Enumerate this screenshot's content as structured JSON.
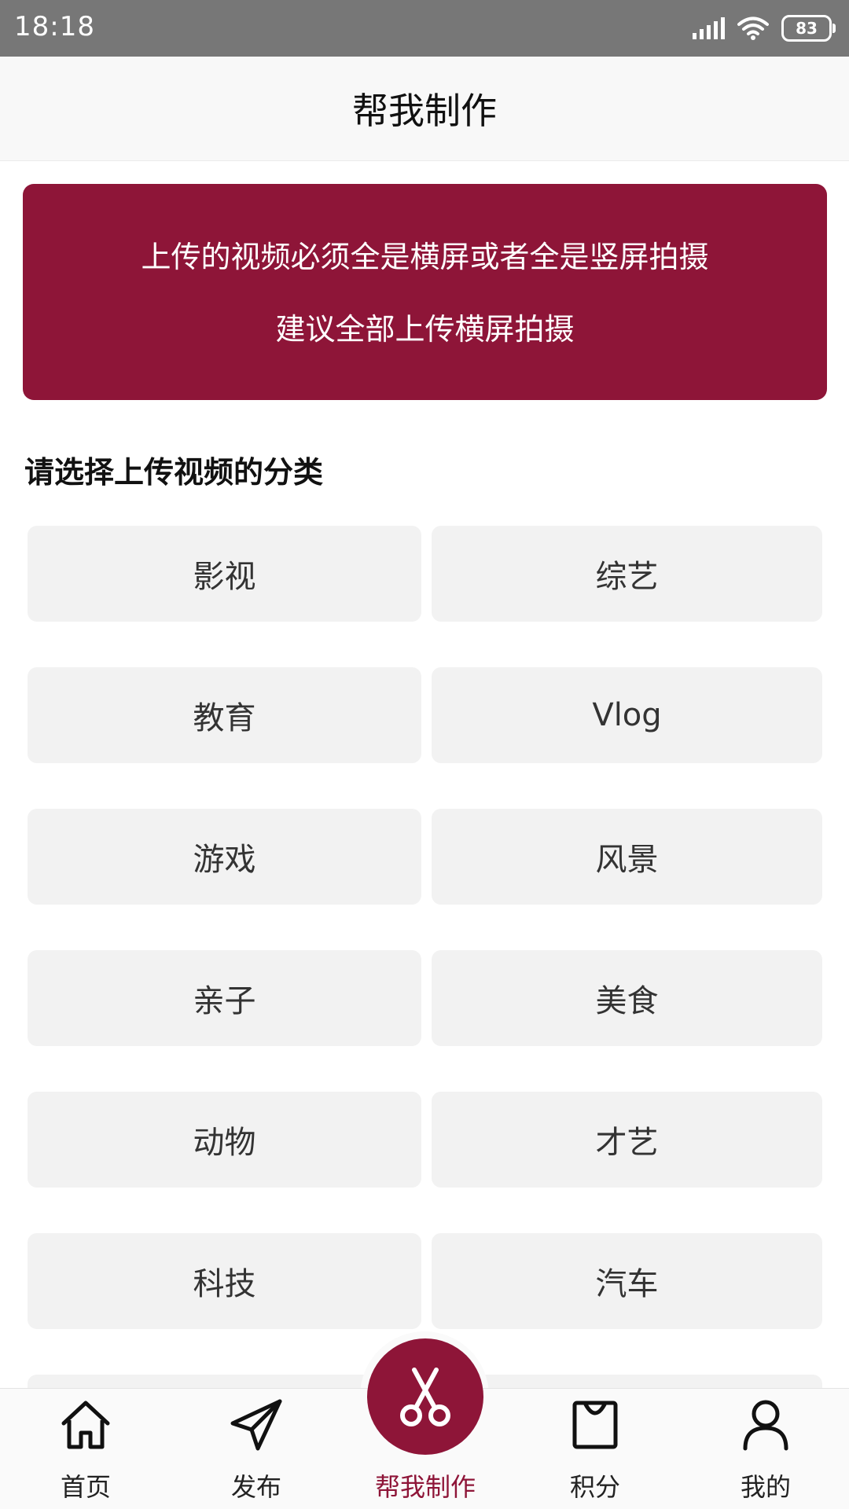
{
  "status_bar": {
    "time": "18:18",
    "battery": "83",
    "icons": [
      "signal-icon",
      "wifi-icon",
      "battery-icon"
    ]
  },
  "header": {
    "title": "帮我制作"
  },
  "notice": {
    "line1": "上传的视频必须全是横屏或者全是竖屏拍摄",
    "line2": "建议全部上传横屏拍摄",
    "background_color": "#8e1538"
  },
  "section": {
    "title": "请选择上传视频的分类"
  },
  "categories": [
    "影视",
    "综艺",
    "教育",
    "Vlog",
    "游戏",
    "风景",
    "亲子",
    "美食",
    "动物",
    "才艺",
    "科技",
    "汽车"
  ],
  "bottom_nav": {
    "items": [
      {
        "label": "首页",
        "icon": "home-icon"
      },
      {
        "label": "发布",
        "icon": "send-icon"
      },
      {
        "label": "帮我制作",
        "icon": "scissors-icon",
        "active": true
      },
      {
        "label": "积分",
        "icon": "bag-icon"
      },
      {
        "label": "我的",
        "icon": "user-icon"
      }
    ],
    "active_color": "#8e1538"
  }
}
